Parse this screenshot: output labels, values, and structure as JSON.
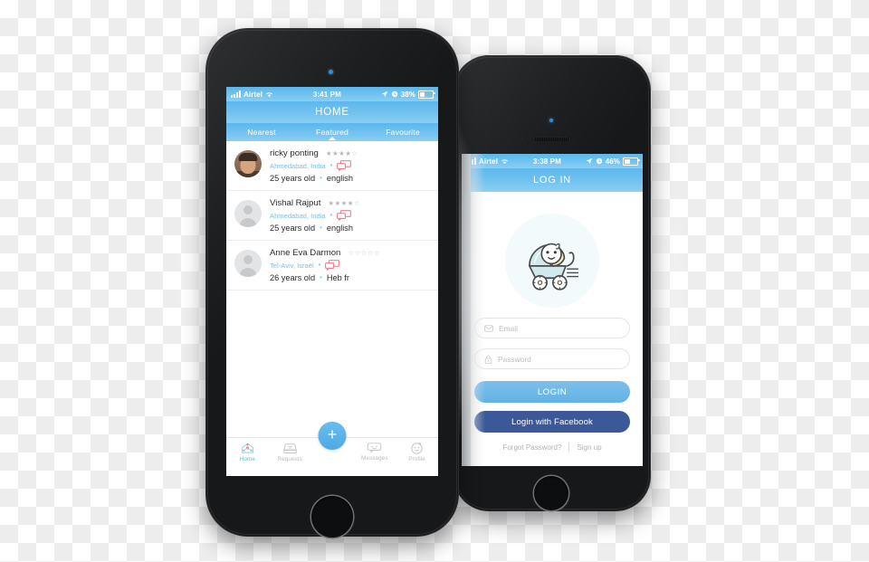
{
  "scene": {
    "description": "Two iPhone mockups showing a parenting/babysitting app",
    "accent_blue": "#5cb7ec",
    "facebook_blue": "#3b5998",
    "message_icon_pink": "#f0808f"
  },
  "front_phone": {
    "status_bar": {
      "carrier": "Airtel",
      "signal_icon": "signal-bars-icon",
      "wifi_icon": "wifi-icon",
      "time": "3:41 PM",
      "location_icon": "location-arrow-icon",
      "alarm_icon": "alarm-clock-icon",
      "battery_percent": "38%",
      "battery_icon": "battery-icon"
    },
    "nav": {
      "title": "HOME"
    },
    "tabs": [
      {
        "label": "Nearest",
        "active": false
      },
      {
        "label": "Featured",
        "active": true
      },
      {
        "label": "Favourite",
        "active": false
      }
    ],
    "list": [
      {
        "name": "ricky ponting",
        "rating_filled": 4,
        "rating_total": 5,
        "location": "Ahmedabad, India",
        "age": "25 years old",
        "language": "english",
        "avatar_type": "photo",
        "message_icon": "chat-bubble-icon"
      },
      {
        "name": "Vishal Rajput",
        "rating_filled": 4,
        "rating_total": 5,
        "location": "Ahmedabad, India",
        "age": "25 years old",
        "language": "english",
        "avatar_type": "placeholder",
        "message_icon": "chat-bubble-icon"
      },
      {
        "name": "Anne Eva  Darmon",
        "rating_filled": 0,
        "rating_total": 5,
        "location": "Tel-Aviv, Israël",
        "age": "26 years old",
        "language": "Heb fr",
        "avatar_type": "placeholder",
        "message_icon": "chat-bubble-icon"
      }
    ],
    "tabbar": {
      "add_button_label": "+",
      "items": [
        {
          "label": "Home",
          "icon": "home-network-icon",
          "active": true
        },
        {
          "label": "Requests",
          "icon": "inbox-tray-icon",
          "active": false
        },
        {
          "label": "Messages",
          "icon": "chat-bubble-icon",
          "active": false
        },
        {
          "label": "Profile",
          "icon": "baby-face-icon",
          "active": false
        }
      ]
    }
  },
  "back_phone": {
    "status_bar": {
      "carrier": "Airtel",
      "signal_icon": "signal-bars-icon",
      "wifi_icon": "wifi-icon",
      "time": "3:38 PM",
      "location_icon": "location-arrow-icon",
      "alarm_icon": "alarm-clock-icon",
      "battery_percent": "46%",
      "battery_icon": "battery-icon"
    },
    "nav": {
      "title": "LOG IN"
    },
    "logo": {
      "icon": "baby-stroller-icon"
    },
    "form": {
      "email": {
        "placeholder": "Email",
        "value": "",
        "icon": "envelope-icon"
      },
      "password": {
        "placeholder": "Password",
        "value": "",
        "icon": "lock-icon"
      }
    },
    "buttons": {
      "login": "LOGIN",
      "facebook": "Login with Facebook"
    },
    "footer": {
      "forgot_password": "Forgot Password?",
      "sign_up": "Sign up"
    }
  }
}
